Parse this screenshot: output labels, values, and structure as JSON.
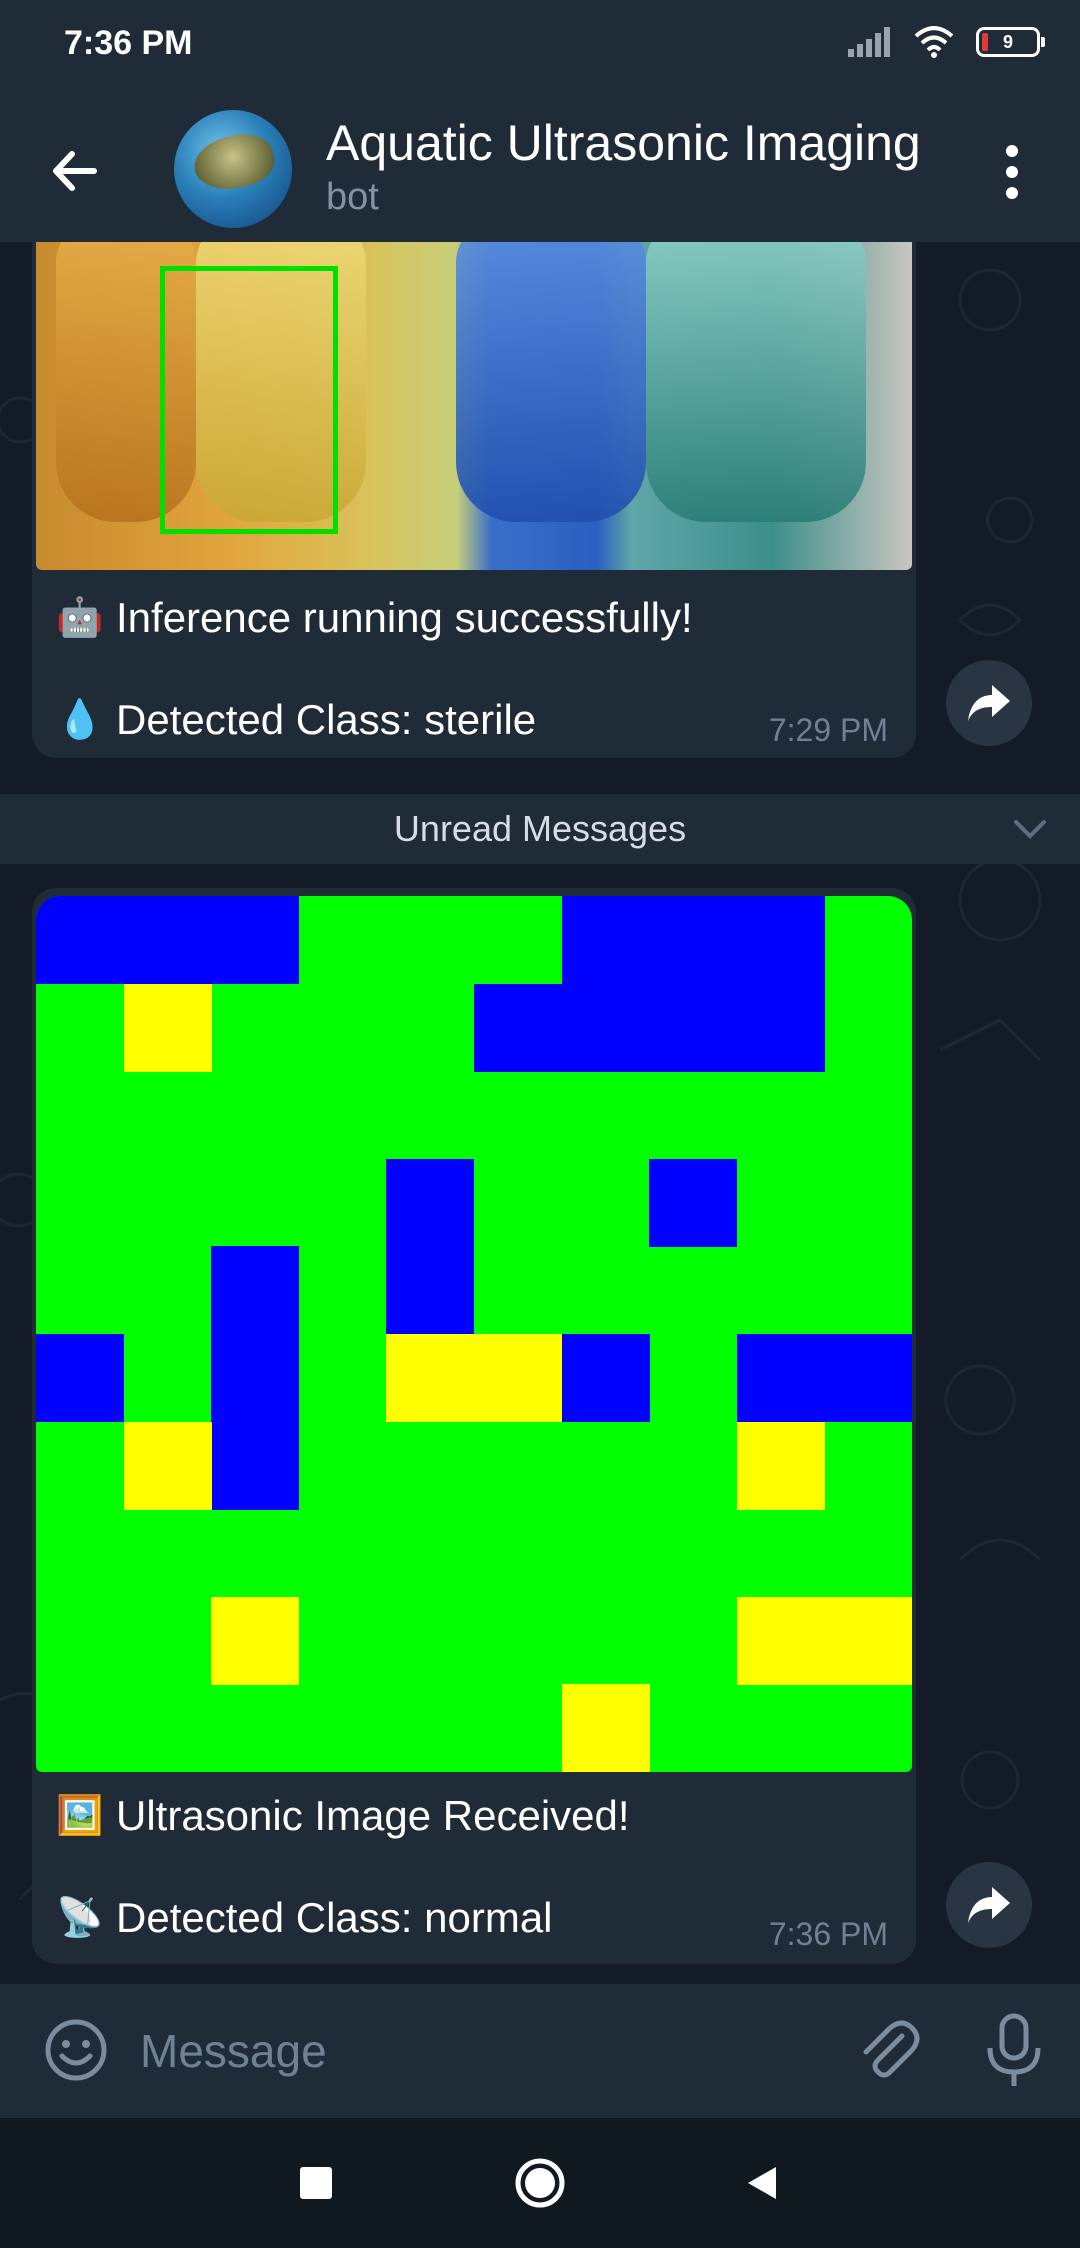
{
  "status_bar": {
    "time": "7:36 PM",
    "battery": "9"
  },
  "header": {
    "title": "Aquatic Ultrasonic Imaging",
    "subtitle": "bot"
  },
  "messages": [
    {
      "line1": {
        "emoji": "🤖",
        "text": "Inference running successfully!"
      },
      "line2": {
        "emoji": "💧",
        "text": "Detected Class: sterile"
      },
      "time": "7:29 PM"
    },
    {
      "line1": {
        "emoji": "🖼️",
        "text": "Ultrasonic Image Received!"
      },
      "line2": {
        "emoji": "📡",
        "text": "Detected Class: normal"
      },
      "time": "7:36 PM"
    }
  ],
  "unread_divider": {
    "label": "Unread Messages"
  },
  "composer": {
    "placeholder": "Message"
  },
  "colors": {
    "header_bg": "#202b38",
    "chat_bg": "#121b26",
    "bubble_bg": "#202b38",
    "grid_green": "#00ff00",
    "grid_blue": "#0000ff",
    "grid_yellow": "#ffff00"
  },
  "grid_image": {
    "size": 10,
    "base": "green",
    "blue_cells": [
      [
        0,
        0
      ],
      [
        1,
        0
      ],
      [
        2,
        0
      ],
      [
        6,
        0
      ],
      [
        7,
        0
      ],
      [
        8,
        0
      ],
      [
        5,
        1
      ],
      [
        6,
        1
      ],
      [
        7,
        1
      ],
      [
        8,
        1
      ],
      [
        4,
        3
      ],
      [
        7,
        3
      ],
      [
        2,
        4
      ],
      [
        4,
        4
      ],
      [
        0,
        5
      ],
      [
        2,
        5
      ],
      [
        6,
        5
      ],
      [
        8,
        5
      ],
      [
        9,
        5
      ],
      [
        2,
        6
      ]
    ],
    "yellow_cells": [
      [
        1,
        1
      ],
      [
        4,
        5
      ],
      [
        5,
        5
      ],
      [
        1,
        6
      ],
      [
        8,
        6
      ],
      [
        2,
        8
      ],
      [
        8,
        8
      ],
      [
        9,
        8
      ],
      [
        6,
        9
      ]
    ]
  }
}
